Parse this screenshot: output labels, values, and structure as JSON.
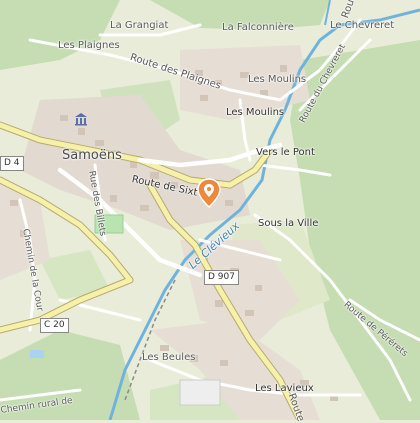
{
  "map": {
    "colors": {
      "background": "#e9ecd9",
      "forest": "#c6ddb3",
      "water": "#aad3f2",
      "river": "#6fb3dd",
      "road": "#ffffff",
      "main_road": "#f6f1a9",
      "building": "#d9cfc4",
      "pin": "#f0883a"
    },
    "places": {
      "grangiat": "La Grangiat",
      "falconniere": "La Falconnière",
      "plaignes": "Les Plaignes",
      "route_plaignes": "Route des Plaignes",
      "chevreret": "Le Chevreret",
      "route_chevreret": "Route du Chevreret",
      "route_chevreret_top": "Route",
      "les_moulins_1": "Les Moulins",
      "les_moulins_2": "Les Moulins",
      "samoens": "Samoëns",
      "vers_le_pont": "Vers le Pont",
      "route_sixt": "Route de Sixt",
      "route_billets": "Rue des Billets",
      "chemin_cour": "Chemin de la Cour",
      "sous_la_ville": "Sous la Ville",
      "le_clevieux": "Le Clévieux",
      "route_perieres": "Route de Pérérets",
      "les_beules": "Les Beules",
      "les_lavieux": "Les Lavieux",
      "route_bottom": "Route",
      "chemin_rural": "Chemin rural de"
    },
    "roads": {
      "d4": "D 4",
      "d907": "D 907",
      "c20": "C 20"
    },
    "marker": {
      "icon": "location-pin-icon"
    },
    "poi": {
      "icon": "town-hall-icon"
    }
  }
}
